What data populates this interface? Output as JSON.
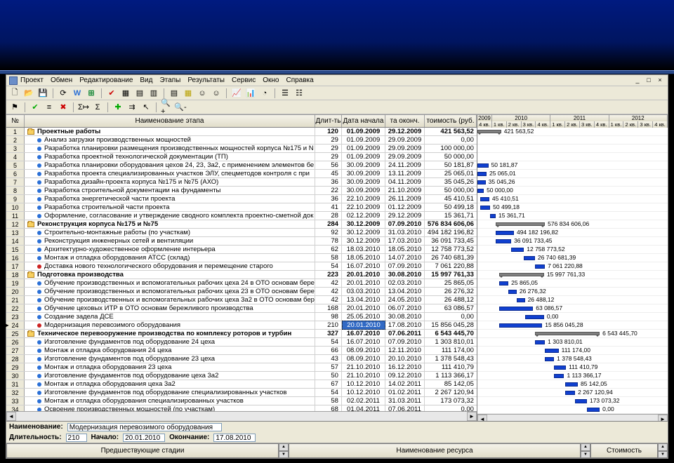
{
  "menu": {
    "items": [
      "Проект",
      "Обмен",
      "Редактирование",
      "Вид",
      "Этапы",
      "Результаты",
      "Сервис",
      "Окно",
      "Справка"
    ],
    "window_controls": [
      "_",
      "□",
      "×"
    ]
  },
  "columns": {
    "rownum": "№",
    "name": "Наименование этапа",
    "dur": "Длит-ть",
    "start": "Дата начала",
    "end": "та оконч.",
    "cost": "тоимость (руб."
  },
  "timeline": {
    "years": [
      {
        "label": "2009",
        "quarters": [
          "4 кв."
        ]
      },
      {
        "label": "2010",
        "quarters": [
          "1 кв.",
          "2 кв.",
          "3 кв.",
          "4 кв."
        ]
      },
      {
        "label": "2011",
        "quarters": [
          "1 кв.",
          "2 кв.",
          "3 кв.",
          "4 кв."
        ]
      },
      {
        "label": "2012",
        "quarters": [
          "1 кв.",
          "2 кв.",
          "3 кв.",
          "4 кв."
        ]
      }
    ],
    "quarter_width": 26
  },
  "rows": [
    {
      "n": 1,
      "type": "folder",
      "lvl": 0,
      "name": "Проектные работы",
      "dur": 120,
      "start": "01.09.2009",
      "end": "29.12.2009",
      "cost": "421 563,52",
      "bar": {
        "kind": "summary",
        "q0": 0,
        "q1": 1.3,
        "label": "421 563,52"
      }
    },
    {
      "n": 2,
      "type": "task",
      "lvl": 1,
      "b": "blue",
      "name": "Анализ загрузки производственных мощностей",
      "dur": 29,
      "start": "01.09.2009",
      "end": "29.09.2009",
      "cost": "0,00"
    },
    {
      "n": 3,
      "type": "task",
      "lvl": 1,
      "b": "blue",
      "name": "Разработка планировки размещения производственных мощностей корпуса №175 и N",
      "dur": 29,
      "start": "01.09.2009",
      "end": "29.09.2009",
      "cost": "100 000,00"
    },
    {
      "n": 4,
      "type": "task",
      "lvl": 1,
      "b": "blue",
      "name": "Разработка проектной технологической документации (ТП)",
      "dur": 29,
      "start": "01.09.2009",
      "end": "29.09.2009",
      "cost": "50 000,00"
    },
    {
      "n": 5,
      "type": "task",
      "lvl": 1,
      "b": "blue",
      "name": "Разработка планировки оборудования цехов 24, 23, 3а2, с применением элементов бе",
      "dur": 56,
      "start": "30.09.2009",
      "end": "24.11.2009",
      "cost": "50 181,87",
      "bar": {
        "kind": "task",
        "q0": 0,
        "q1": 0.6,
        "label": "50 181,87"
      }
    },
    {
      "n": 6,
      "type": "task",
      "lvl": 1,
      "b": "blue",
      "name": "Разработка проекта специализированных участков ЭЛУ, спецметодов контроля с при",
      "dur": 45,
      "start": "30.09.2009",
      "end": "13.11.2009",
      "cost": "25 065,01",
      "bar": {
        "kind": "task",
        "q0": 0,
        "q1": 0.5,
        "label": "25 065,01"
      }
    },
    {
      "n": 7,
      "type": "task",
      "lvl": 1,
      "b": "blue",
      "name": "Разработка дизайн-проекта корпуса №175 и №75 (АХО)",
      "dur": 36,
      "start": "30.09.2009",
      "end": "04.11.2009",
      "cost": "35 045,26",
      "bar": {
        "kind": "task",
        "q0": 0,
        "q1": 0.45,
        "label": "35 045,26"
      }
    },
    {
      "n": 8,
      "type": "task",
      "lvl": 1,
      "b": "blue",
      "name": "Разработка строительной документации на фундаменты",
      "dur": 22,
      "start": "30.09.2009",
      "end": "21.10.2009",
      "cost": "50 000,00",
      "bar": {
        "kind": "task",
        "q0": 0,
        "q1": 0.35,
        "label": "50 000,00"
      }
    },
    {
      "n": 9,
      "type": "task",
      "lvl": 1,
      "b": "blue",
      "name": "Разработка энергетической части проекта",
      "dur": 36,
      "start": "22.10.2009",
      "end": "26.11.2009",
      "cost": "45 410,51",
      "bar": {
        "kind": "task",
        "q0": 0.15,
        "q1": 0.65,
        "label": "45 410,51"
      }
    },
    {
      "n": 10,
      "type": "task",
      "lvl": 1,
      "b": "blue",
      "name": "Разработка строительной части проекта",
      "dur": 41,
      "start": "22.10.2009",
      "end": "01.12.2009",
      "cost": "50 499,18",
      "bar": {
        "kind": "task",
        "q0": 0.15,
        "q1": 0.7,
        "label": "50 499,18"
      }
    },
    {
      "n": 11,
      "type": "task",
      "lvl": 1,
      "b": "blue",
      "name": "Оформление, согласование и утверждение сводного комплекта проектно-сметной док",
      "dur": 28,
      "start": "02.12.2009",
      "end": "29.12.2009",
      "cost": "15 361,71",
      "bar": {
        "kind": "task",
        "q0": 0.7,
        "q1": 1.0,
        "label": "15 361,71"
      }
    },
    {
      "n": 12,
      "type": "folder",
      "lvl": 0,
      "name": "Реконструкция корпуса №175 и №75",
      "dur": 284,
      "start": "30.12.2009",
      "end": "07.09.2010",
      "cost": "576 834 606,06",
      "bar": {
        "kind": "summary",
        "q0": 1.0,
        "q1": 3.7,
        "label": "576 834 606,06"
      }
    },
    {
      "n": 13,
      "type": "task",
      "lvl": 1,
      "b": "blue",
      "name": "Строительно-монтажные работы (по участкам)",
      "dur": 92,
      "start": "30.12.2009",
      "end": "31.03.2010",
      "cost": "494 182 196,82",
      "bar": {
        "kind": "task",
        "q0": 1.0,
        "q1": 2.0,
        "label": "494 182 196,82"
      }
    },
    {
      "n": 14,
      "type": "task",
      "lvl": 1,
      "b": "blue",
      "name": "Реконструкция инженерных сетей и вентиляции",
      "dur": 78,
      "start": "30.12.2009",
      "end": "17.03.2010",
      "cost": "36 091 733,45",
      "bar": {
        "kind": "task",
        "q0": 1.0,
        "q1": 1.85,
        "label": "36 091 733,45"
      }
    },
    {
      "n": 15,
      "type": "task",
      "lvl": 1,
      "b": "blue",
      "name": "Архитектурно-художественное оформление интерьера",
      "dur": 62,
      "start": "18.03.2010",
      "end": "18.05.2010",
      "cost": "12 758 773,52",
      "bar": {
        "kind": "task",
        "q0": 1.85,
        "q1": 2.55,
        "label": "12 758 773,52"
      }
    },
    {
      "n": 16,
      "type": "task",
      "lvl": 1,
      "b": "blue",
      "name": "Монтаж и отладка оборудования АТСС (склад)",
      "dur": 58,
      "start": "18.05.2010",
      "end": "14.07.2010",
      "cost": "26 740 681,39",
      "bar": {
        "kind": "task",
        "q0": 2.55,
        "q1": 3.15,
        "label": "26 740 681,39"
      }
    },
    {
      "n": 17,
      "type": "task",
      "lvl": 1,
      "b": "red",
      "name": "Доставка нового технологического оборудования и перемещение старого",
      "dur": 54,
      "start": "16.07.2010",
      "end": "07.09.2010",
      "cost": "7 061 220,88",
      "bar": {
        "kind": "task",
        "q0": 3.15,
        "q1": 3.7,
        "label": "7 061 220,88"
      }
    },
    {
      "n": 18,
      "type": "folder",
      "lvl": 0,
      "name": "Подготовка производства",
      "dur": 223,
      "start": "20.01.2010",
      "end": "30.08.2010",
      "cost": "15 997 761,33",
      "bar": {
        "kind": "summary",
        "q0": 1.2,
        "q1": 3.65,
        "label": "15 997 761,33"
      }
    },
    {
      "n": 19,
      "type": "task",
      "lvl": 1,
      "b": "blue",
      "name": "Обучение производственных и вспомогательных рабочих цеха 24 в ОТО основам бере",
      "dur": 42,
      "start": "20.01.2010",
      "end": "02.03.2010",
      "cost": "25 865,05",
      "bar": {
        "kind": "task",
        "q0": 1.2,
        "q1": 1.7,
        "label": "25 865,05"
      }
    },
    {
      "n": 20,
      "type": "task",
      "lvl": 1,
      "b": "blue",
      "name": "Обучение производственных и вспомогательных рабочих цеха 23 в ОТО основам бере",
      "dur": 42,
      "start": "03.03.2010",
      "end": "13.04.2010",
      "cost": "26 276,32",
      "bar": {
        "kind": "task",
        "q0": 1.7,
        "q1": 2.15,
        "label": "26 276,32"
      }
    },
    {
      "n": 21,
      "type": "task",
      "lvl": 1,
      "b": "blue",
      "name": "Обучение производственных и вспомогательных рабочих цеха 3а2 в ОТО основам бер",
      "dur": 42,
      "start": "13.04.2010",
      "end": "24.05.2010",
      "cost": "26 488,12",
      "bar": {
        "kind": "task",
        "q0": 2.15,
        "q1": 2.6,
        "label": "26 488,12"
      }
    },
    {
      "n": 22,
      "type": "task",
      "lvl": 1,
      "b": "blue",
      "name": "Обучение цеховых ИТР в ОТО основам бережливого производства",
      "dur": 168,
      "start": "20.01.2010",
      "end": "06.07.2010",
      "cost": "63 086,57",
      "bar": {
        "kind": "task",
        "q0": 1.2,
        "q1": 3.05,
        "label": "63 086,57"
      }
    },
    {
      "n": 23,
      "type": "task",
      "lvl": 1,
      "b": "blue",
      "name": "Создание задела ДСЕ",
      "dur": 98,
      "start": "25.05.2010",
      "end": "30.08.2010",
      "cost": "0,00",
      "bar": {
        "kind": "task",
        "q0": 2.6,
        "q1": 3.65,
        "label": "0,00"
      }
    },
    {
      "n": 24,
      "type": "task",
      "lvl": 1,
      "b": "red",
      "selected": true,
      "name": "Модернизация перевозимого оборудования",
      "dur": 210,
      "start": "20.01.2010",
      "end": "17.08.2010",
      "cost": "15 856 045,28",
      "bar": {
        "kind": "task",
        "q0": 1.2,
        "q1": 3.55,
        "label": "15 856 045,28"
      }
    },
    {
      "n": 25,
      "type": "folder",
      "lvl": 0,
      "name": "Техническое перевооружение производства по  комплексу роторов и турбин",
      "dur": 327,
      "start": "16.07.2010",
      "end": "07.06.2011",
      "cost": "6 543 445,70",
      "bar": {
        "kind": "summary",
        "q0": 3.15,
        "q1": 6.7,
        "label": "6 543 445,70"
      }
    },
    {
      "n": 26,
      "type": "task",
      "lvl": 1,
      "b": "blue",
      "name": "Изготовление фундаментов под оборудование 24 цеха",
      "dur": 54,
      "start": "16.07.2010",
      "end": "07.09.2010",
      "cost": "1 303 810,01",
      "bar": {
        "kind": "task",
        "q0": 3.15,
        "q1": 3.7,
        "label": "1 303 810,01"
      }
    },
    {
      "n": 27,
      "type": "task",
      "lvl": 1,
      "b": "blue",
      "name": "Монтаж и отладка оборудования 24 цеха",
      "dur": 66,
      "start": "08.09.2010",
      "end": "12.11.2010",
      "cost": "111 174,00",
      "bar": {
        "kind": "task",
        "q0": 3.7,
        "q1": 4.45,
        "label": "111 174,00"
      }
    },
    {
      "n": 28,
      "type": "task",
      "lvl": 1,
      "b": "blue",
      "name": "Изготовление фундаментов под оборудование 23 цеха",
      "dur": 43,
      "start": "08.09.2010",
      "end": "20.10.2010",
      "cost": "1 378 548,43",
      "bar": {
        "kind": "task",
        "q0": 3.7,
        "q1": 4.2,
        "label": "1 378 548,43"
      }
    },
    {
      "n": 29,
      "type": "task",
      "lvl": 1,
      "b": "blue",
      "name": "Монтаж и отладка оборудования 23 цеха",
      "dur": 57,
      "start": "21.10.2010",
      "end": "16.12.2010",
      "cost": "111 410,79",
      "bar": {
        "kind": "task",
        "q0": 4.2,
        "q1": 4.85,
        "label": "111 410,79"
      }
    },
    {
      "n": 30,
      "type": "task",
      "lvl": 1,
      "b": "blue",
      "name": "Изготовление фундаментов под оборудование цеха 3а2",
      "dur": 50,
      "start": "21.10.2010",
      "end": "09.12.2010",
      "cost": "1 113 366,17",
      "bar": {
        "kind": "task",
        "q0": 4.2,
        "q1": 4.75,
        "label": "1 113 366,17"
      }
    },
    {
      "n": 31,
      "type": "task",
      "lvl": 1,
      "b": "blue",
      "name": "Монтаж и отладка оборудования цеха 3а2",
      "dur": 67,
      "start": "10.12.2010",
      "end": "14.02.2011",
      "cost": "85 142,05",
      "bar": {
        "kind": "task",
        "q0": 4.8,
        "q1": 5.5,
        "label": "85 142,05"
      }
    },
    {
      "n": 32,
      "type": "task",
      "lvl": 1,
      "b": "blue",
      "name": "Изготовление фундаментов под оборудование специализированных участков",
      "dur": 54,
      "start": "10.12.2010",
      "end": "01.02.2011",
      "cost": "2 267 120,94",
      "bar": {
        "kind": "task",
        "q0": 4.8,
        "q1": 5.35,
        "label": "2 267 120,94"
      }
    },
    {
      "n": 33,
      "type": "task",
      "lvl": 1,
      "b": "blue",
      "name": "Монтаж и отладка оборудования специализированных участков",
      "dur": 58,
      "start": "02.02.2011",
      "end": "31.03.2011",
      "cost": "173 073,32",
      "bar": {
        "kind": "task",
        "q0": 5.35,
        "q1": 6.0,
        "label": "173 073,32"
      }
    },
    {
      "n": 34,
      "type": "task",
      "lvl": 1,
      "b": "blue",
      "name": "Освоение производственных мощностей (по участкам)",
      "dur": 68,
      "start": "01.04.2011",
      "end": "07.06.2011",
      "cost": "0,00",
      "bar": {
        "kind": "task",
        "q0": 6.0,
        "q1": 6.7,
        "label": "0,00"
      }
    }
  ],
  "footer": {
    "name_label": "Наименование:",
    "duration_label": "Длительность:",
    "start_label": "Начало:",
    "end_label": "Окончание:",
    "name_value": "Модернизация перевозимого оборудования",
    "duration_value": "210",
    "start_value": "20.01.2010",
    "end_value": "17.08.2010",
    "btn_prev": "Предшествующие стадии",
    "btn_res": "Наименование ресурса",
    "btn_cost": "Стоимость"
  }
}
